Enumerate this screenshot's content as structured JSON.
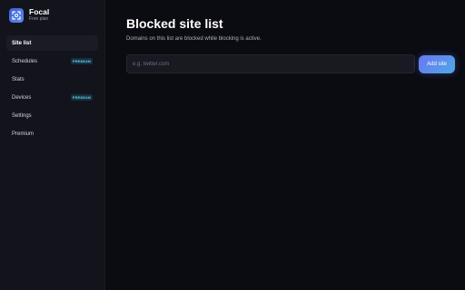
{
  "app": {
    "name": "Focal",
    "plan": "Free plan"
  },
  "sidebar": {
    "items": [
      {
        "label": "Site list",
        "badge": "",
        "active": true
      },
      {
        "label": "Schedules",
        "badge": "PREMIUM",
        "active": false
      },
      {
        "label": "Stats",
        "badge": "",
        "active": false
      },
      {
        "label": "Devices",
        "badge": "PREMIUM",
        "active": false
      },
      {
        "label": "Settings",
        "badge": "",
        "active": false
      },
      {
        "label": "Premium",
        "badge": "",
        "active": false
      }
    ]
  },
  "main": {
    "title": "Blocked site list",
    "subtitle": "Domains on this list are blocked while blocking is active.",
    "input": {
      "placeholder": "e.g. twitter.com",
      "value": ""
    },
    "add_button_label": "Add site"
  },
  "colors": {
    "accent_start": "#6b75f2",
    "accent_end": "#4fa8e8",
    "badge_text": "#6ec9e8",
    "background": "#0b0b12",
    "sidebar": "#13131c"
  },
  "icons": {
    "logo": "focus-frame-icon"
  }
}
